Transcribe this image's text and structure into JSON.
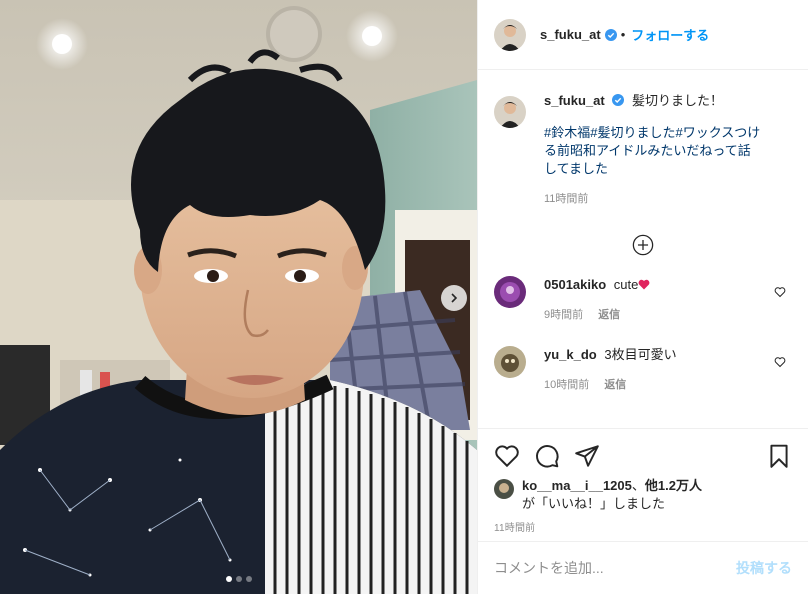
{
  "header": {
    "username": "s_fuku_at",
    "separator": "•",
    "follow_label": "フォローする"
  },
  "caption": {
    "username": "s_fuku_at",
    "text": "髪切りました！",
    "hashtags": "#鈴木福#髪切りました#ワックスつける前昭和アイドルみたいだねって話してました",
    "time": "11時間前"
  },
  "comments": [
    {
      "username": "0501akiko",
      "text": "cute",
      "emoji": "heart-emoji",
      "time": "9時間前",
      "reply_label": "返信"
    },
    {
      "username": "yu_k_do",
      "text": "3枚目可愛い",
      "time": "10時間前",
      "reply_label": "返信"
    }
  ],
  "likes": {
    "line1_user": "ko__ma__i__1205",
    "line1_sep": "、",
    "line1_others": "他1.2万人",
    "line2": "が「いいね！」しました"
  },
  "post_time": "11時間前",
  "add_comment": {
    "placeholder": "コメントを追加...",
    "post_label": "投稿する"
  },
  "carousel": {
    "total": 3,
    "current": 1
  },
  "icons": [
    "verified-icon",
    "more-comments-icon",
    "heart-icon",
    "comment-icon",
    "share-icon",
    "bookmark-icon",
    "next-arrow-icon"
  ],
  "colors": {
    "accent": "#0095f6",
    "verified": "#3897f0",
    "hashtag": "#00376b",
    "muted": "#8e8e8e",
    "post_disabled": "#b2dffc"
  }
}
